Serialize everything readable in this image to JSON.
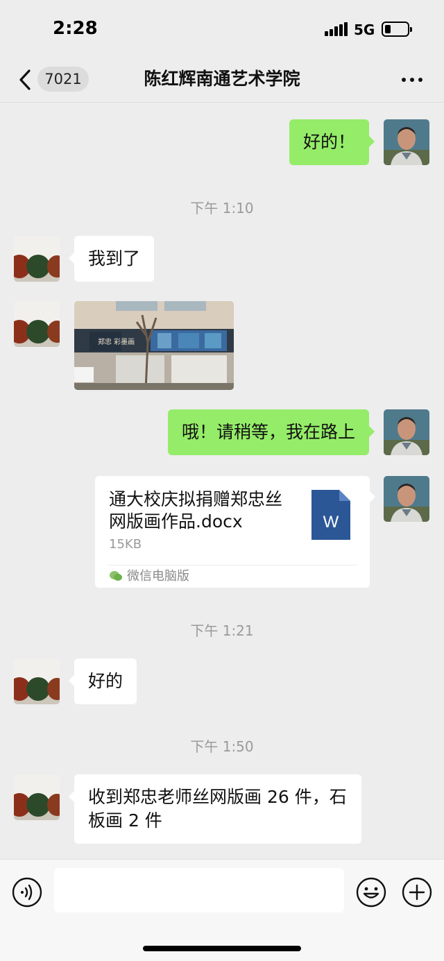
{
  "status_bar": {
    "time": "2:28",
    "network": "5G",
    "battery_level": 0.2
  },
  "nav": {
    "unread_count": "7021",
    "title": "陈红辉南通艺术学院",
    "back_icon": "chevron-left-icon",
    "more_icon": "more-dots-icon"
  },
  "messages": [
    {
      "type": "text",
      "direction": "out",
      "text": "好的！"
    },
    {
      "type": "timestamp",
      "text": "下午 1:10"
    },
    {
      "type": "text",
      "direction": "in",
      "text": "我到了"
    },
    {
      "type": "image",
      "direction": "in",
      "sign_text": "郑忠 彩墨画"
    },
    {
      "type": "text",
      "direction": "out",
      "text": "哦！请稍等，我在路上"
    },
    {
      "type": "file",
      "direction": "out",
      "file_name": "通大校庆拟捐赠郑忠丝网版画作品.docx",
      "file_size": "15KB",
      "source": "微信电脑版",
      "file_icon_letter": "W"
    },
    {
      "type": "timestamp",
      "text": "下午 1:21"
    },
    {
      "type": "text",
      "direction": "in",
      "text": "好的"
    },
    {
      "type": "timestamp",
      "text": "下午 1:50"
    },
    {
      "type": "text",
      "direction": "in",
      "text": "收到郑忠老师丝网版画 26 件，石板画 2 件"
    }
  ],
  "input_bar": {
    "voice_icon": "voice-icon",
    "emoji_icon": "emoji-icon",
    "plus_icon": "plus-icon",
    "placeholder": ""
  },
  "colors": {
    "background": "#ededed",
    "out_bubble": "#95ec69",
    "in_bubble": "#ffffff",
    "timestamp": "#9a9a9a",
    "word_blue": "#2b5797"
  }
}
